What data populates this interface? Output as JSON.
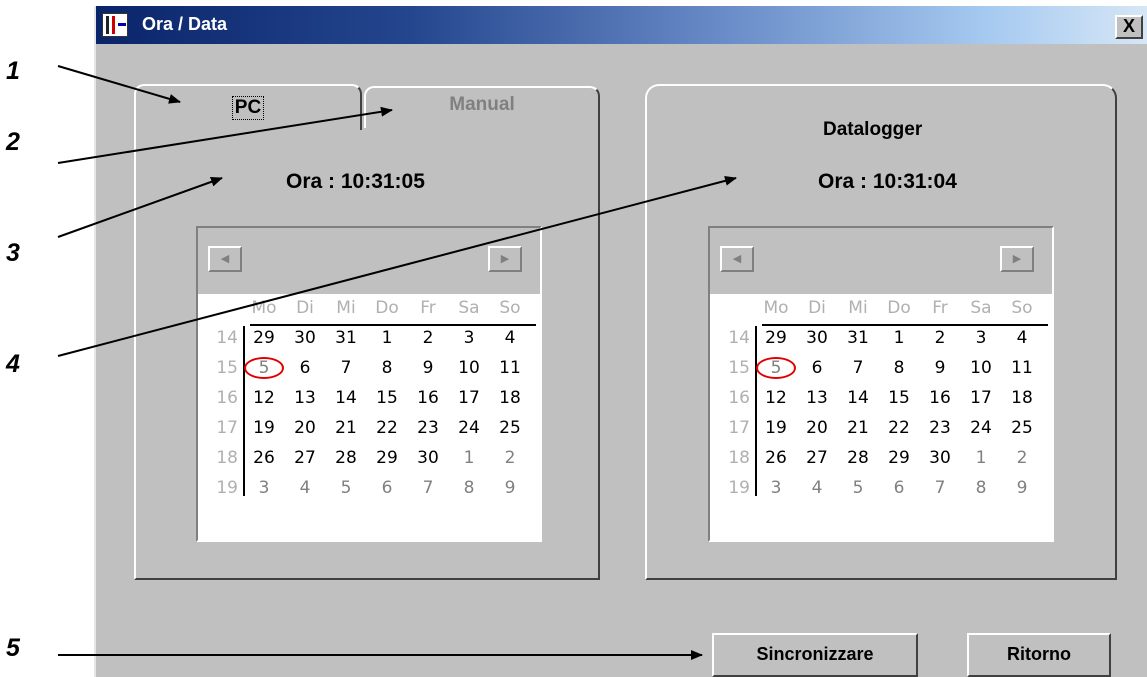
{
  "window": {
    "title": "Ora / Data",
    "close_label": "X"
  },
  "callouts": [
    "1",
    "2",
    "3",
    "4",
    "5"
  ],
  "tabs": [
    {
      "label": "PC",
      "active": true
    },
    {
      "label": "Manual",
      "active": false
    }
  ],
  "pc_panel": {
    "time_label": "Ora : 10:31:05"
  },
  "datalogger_panel": {
    "title": "Datalogger",
    "time_label": "Ora : 10:31:04"
  },
  "calendar": {
    "prev_icon": "left-arrow-icon",
    "next_icon": "right-arrow-icon",
    "weekdays": [
      "Mo",
      "Di",
      "Mi",
      "Do",
      "Fr",
      "Sa",
      "So"
    ],
    "weeks": [
      "14",
      "15",
      "16",
      "17",
      "18",
      "19"
    ],
    "days": [
      [
        {
          "d": "29",
          "m": "cur"
        },
        {
          "d": "30",
          "m": "cur"
        },
        {
          "d": "31",
          "m": "cur"
        },
        {
          "d": "1",
          "m": "cur"
        },
        {
          "d": "2",
          "m": "cur"
        },
        {
          "d": "3",
          "m": "cur"
        },
        {
          "d": "4",
          "m": "cur"
        }
      ],
      [
        {
          "d": "5",
          "m": "today"
        },
        {
          "d": "6",
          "m": "cur"
        },
        {
          "d": "7",
          "m": "cur"
        },
        {
          "d": "8",
          "m": "cur"
        },
        {
          "d": "9",
          "m": "cur"
        },
        {
          "d": "10",
          "m": "cur"
        },
        {
          "d": "11",
          "m": "cur"
        }
      ],
      [
        {
          "d": "12",
          "m": "cur"
        },
        {
          "d": "13",
          "m": "cur"
        },
        {
          "d": "14",
          "m": "cur"
        },
        {
          "d": "15",
          "m": "cur"
        },
        {
          "d": "16",
          "m": "cur"
        },
        {
          "d": "17",
          "m": "cur"
        },
        {
          "d": "18",
          "m": "cur"
        }
      ],
      [
        {
          "d": "19",
          "m": "cur"
        },
        {
          "d": "20",
          "m": "cur"
        },
        {
          "d": "21",
          "m": "cur"
        },
        {
          "d": "22",
          "m": "cur"
        },
        {
          "d": "23",
          "m": "cur"
        },
        {
          "d": "24",
          "m": "cur"
        },
        {
          "d": "25",
          "m": "cur"
        }
      ],
      [
        {
          "d": "26",
          "m": "cur"
        },
        {
          "d": "27",
          "m": "cur"
        },
        {
          "d": "28",
          "m": "cur"
        },
        {
          "d": "29",
          "m": "cur"
        },
        {
          "d": "30",
          "m": "cur"
        },
        {
          "d": "1",
          "m": "oth"
        },
        {
          "d": "2",
          "m": "oth"
        }
      ],
      [
        {
          "d": "3",
          "m": "oth"
        },
        {
          "d": "4",
          "m": "oth"
        },
        {
          "d": "5",
          "m": "oth"
        },
        {
          "d": "6",
          "m": "oth"
        },
        {
          "d": "7",
          "m": "oth"
        },
        {
          "d": "8",
          "m": "oth"
        },
        {
          "d": "9",
          "m": "oth"
        }
      ]
    ]
  },
  "buttons": {
    "sync": "Sincronizzare",
    "back": "Ritorno"
  },
  "colors": {
    "title_gradient_start": "#0a246a",
    "title_gradient_end": "#d6e6f6",
    "window_bg": "#c0c0c0",
    "today_ring": "#e00000"
  }
}
